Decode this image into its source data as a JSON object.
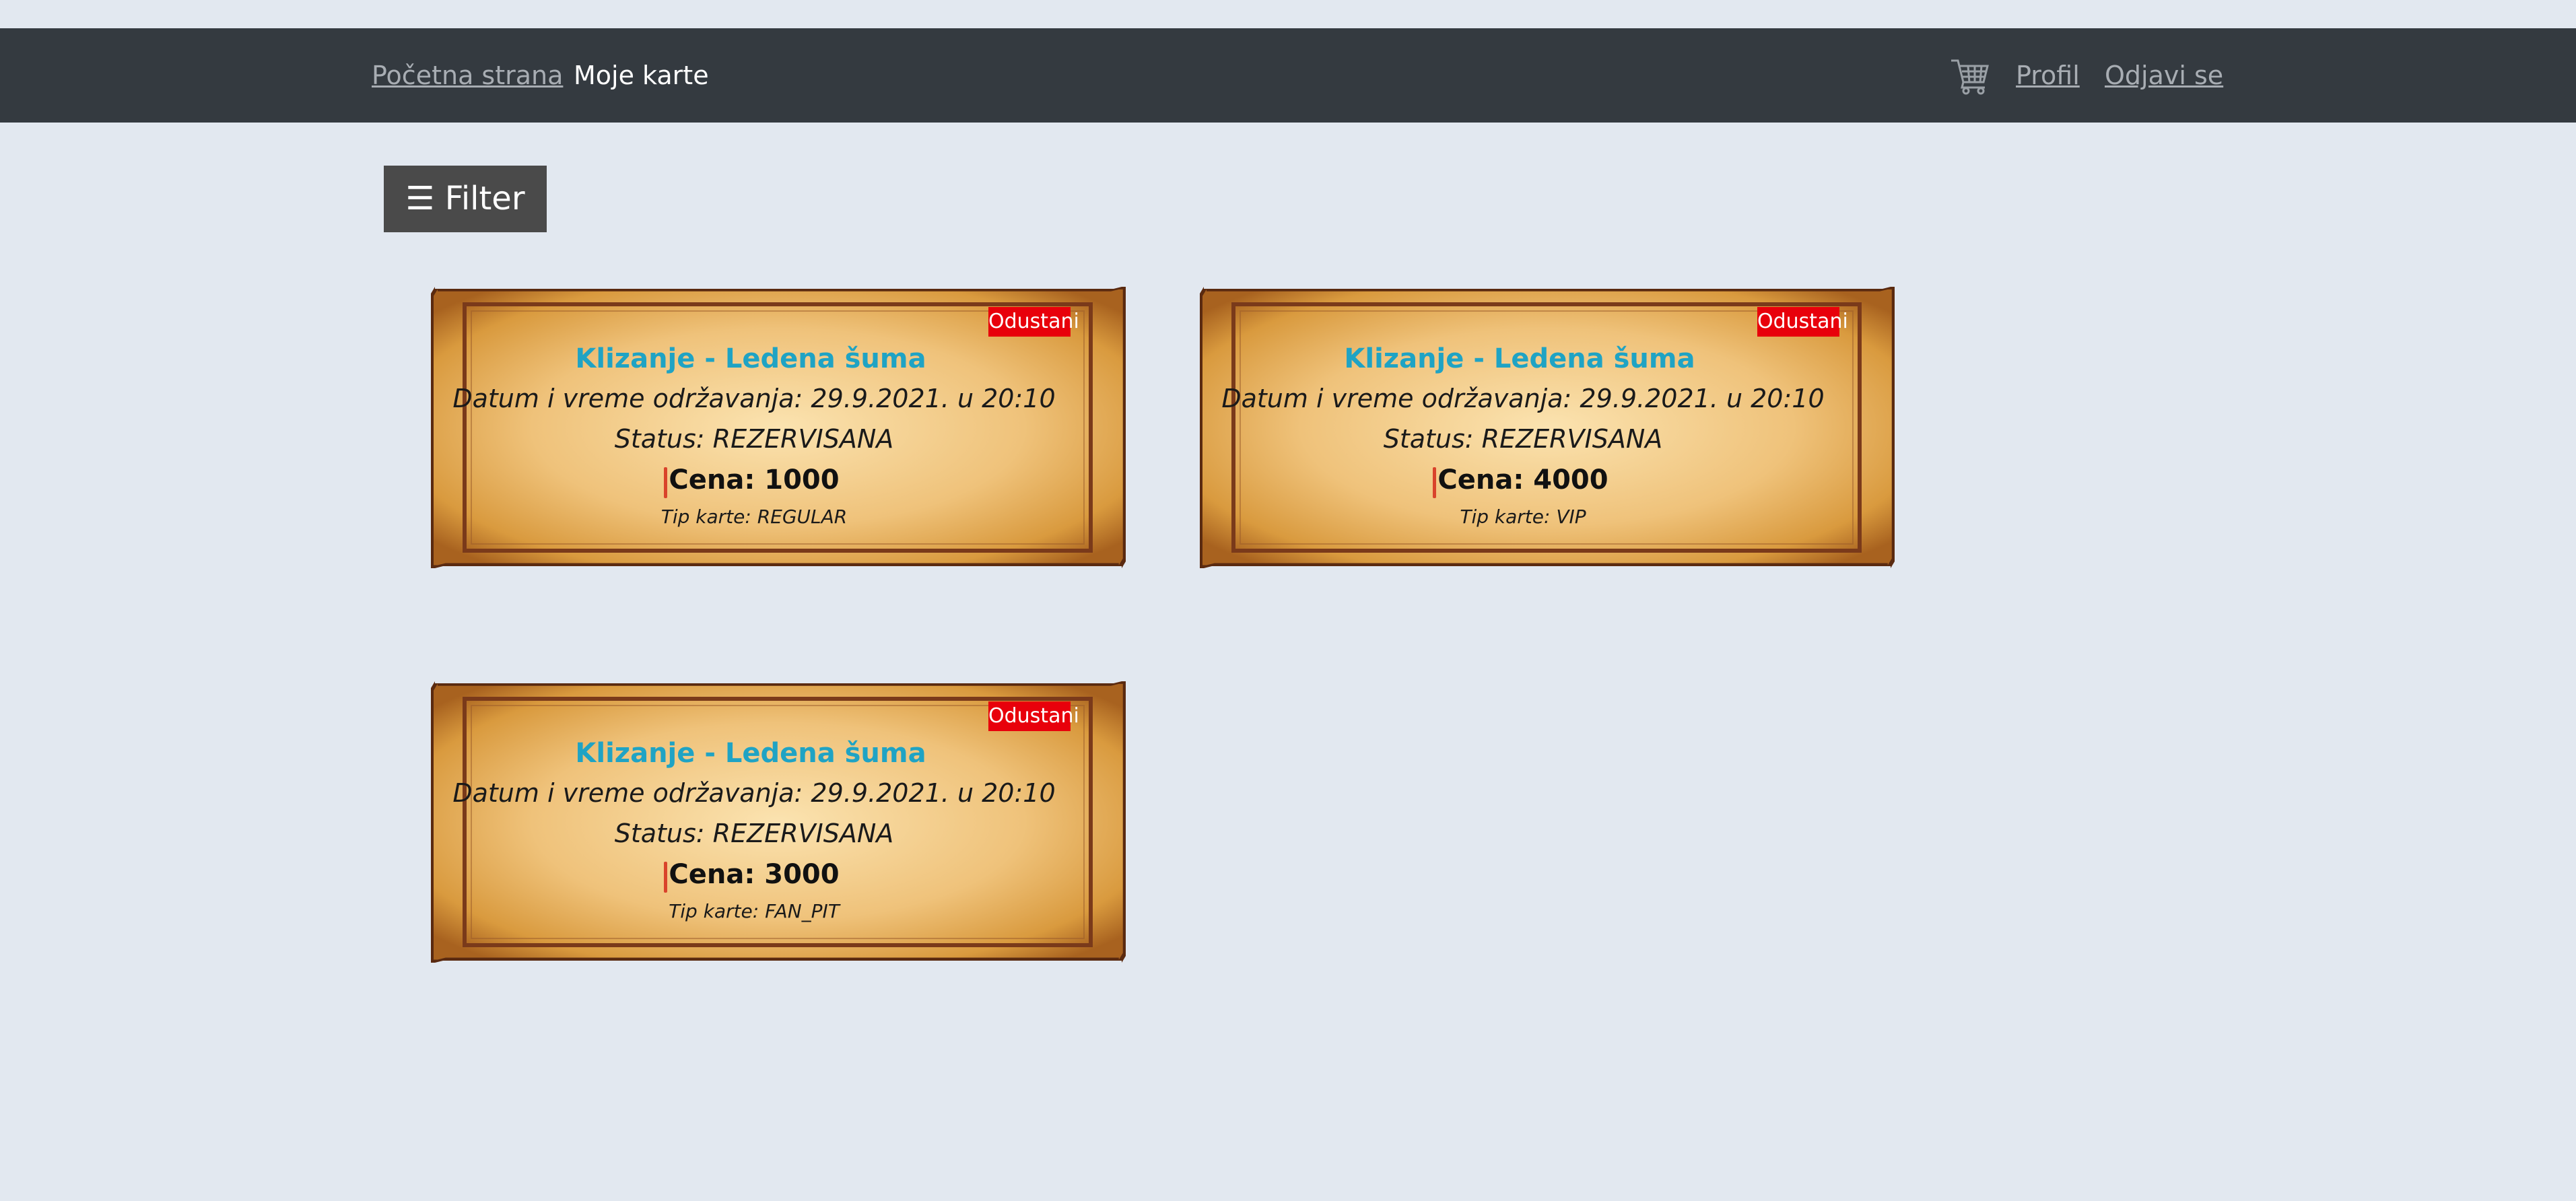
{
  "nav": {
    "home": "Početna strana",
    "my_tickets": "Moje karte",
    "profile": "Profil",
    "logout": "Odjavi se",
    "cart_icon": "shopping-cart-icon"
  },
  "filter": {
    "label": "☰ Filter"
  },
  "tickets": [
    {
      "cancel_label": "Odustani",
      "title": "Klizanje - Ledena šuma",
      "date": "Datum i vreme održavanja: 29.9.2021. u 20:10",
      "status": "Status: REZERVISANA",
      "price": "Cena: 1000",
      "type": "Tip karte: REGULAR"
    },
    {
      "cancel_label": "Odustani",
      "title": "Klizanje - Ledena šuma",
      "date": "Datum i vreme održavanja: 29.9.2021. u 20:10",
      "status": "Status: REZERVISANA",
      "price": "Cena: 4000",
      "type": "Tip karte: VIP"
    },
    {
      "cancel_label": "Odustani",
      "title": "Klizanje - Ledena šuma",
      "date": "Datum i vreme održavanja: 29.9.2021. u 20:10",
      "status": "Status: REZERVISANA",
      "price": "Cena: 3000",
      "type": "Tip karte: FAN_PIT"
    }
  ],
  "colors": {
    "page_bg": "#e2e8f0",
    "navbar_bg": "#343a40",
    "filter_bg": "#4a4a4a",
    "ticket_paper": "#e8b867",
    "ticket_border": "#7a3a1a",
    "title_color": "#1fa3c4",
    "cancel_bg": "#e8000b"
  }
}
